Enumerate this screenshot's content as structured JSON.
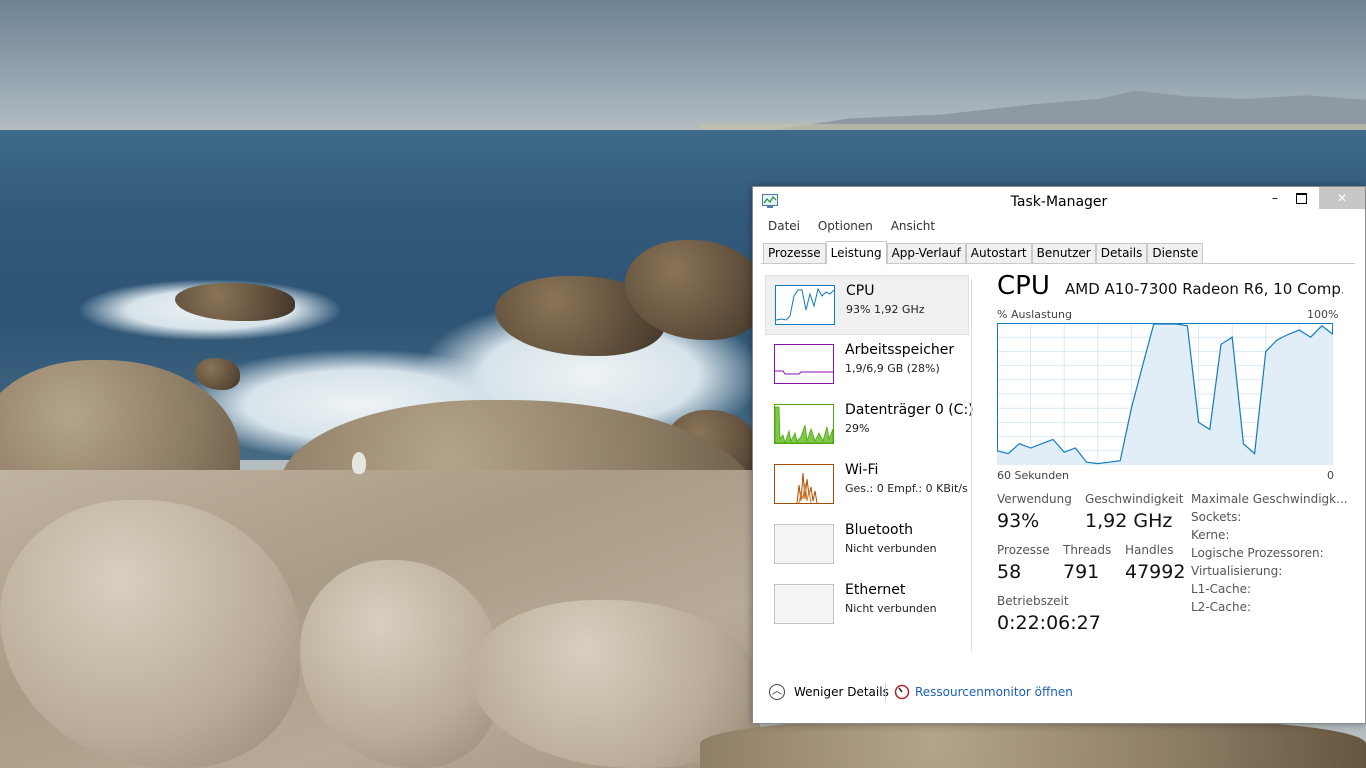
{
  "window": {
    "title": "Task-Manager",
    "controls": {
      "minimize": "–",
      "close": "✕"
    }
  },
  "menu": [
    "Datei",
    "Optionen",
    "Ansicht"
  ],
  "tabs": [
    {
      "label": "Prozesse",
      "active": false
    },
    {
      "label": "Leistung",
      "active": true
    },
    {
      "label": "App-Verlauf",
      "active": false
    },
    {
      "label": "Autostart",
      "active": false
    },
    {
      "label": "Benutzer",
      "active": false
    },
    {
      "label": "Details",
      "active": false
    },
    {
      "label": "Dienste",
      "active": false
    }
  ],
  "resources": [
    {
      "name": "CPU",
      "sub": "93% 1,92 GHz",
      "color": "#117dbb"
    },
    {
      "name": "Arbeitsspeicher",
      "sub": "1,9/6,9 GB (28%)",
      "color": "#8b12ae"
    },
    {
      "name": "Datenträger 0 (C:)",
      "sub": "29%",
      "color": "#4da60c"
    },
    {
      "name": "Wi-Fi",
      "sub": "Ges.: 0 Empf.: 0 KBit/s",
      "color": "#a74f01"
    },
    {
      "name": "Bluetooth",
      "sub": "Nicht verbunden",
      "color": "#a0a0a0"
    },
    {
      "name": "Ethernet",
      "sub": "Nicht verbunden",
      "color": "#a0a0a0"
    }
  ],
  "detail": {
    "title": "CPU",
    "cpu_name": "AMD A10-7300 Radeon R6, 10 Comp...",
    "graph_label": "% Auslastung",
    "graph_max": "100%",
    "time_label": "60 Sekunden",
    "time_min": "0",
    "stats": {
      "usage_label": "Verwendung",
      "usage": "93%",
      "speed_label": "Geschwindigkeit",
      "speed": "1,92 GHz",
      "processes_label": "Prozesse",
      "processes": "58",
      "threads_label": "Threads",
      "threads": "791",
      "handles_label": "Handles",
      "handles": "47992",
      "uptime_label": "Betriebszeit",
      "uptime": "0:22:06:27"
    },
    "specs": [
      "Maximale Geschwindigk...",
      "Sockets:",
      "Kerne:",
      "Logische Prozessoren:",
      "Virtualisierung:",
      "L1-Cache:",
      "L2-Cache:"
    ]
  },
  "footer": {
    "fewer_details": "Weniger Details",
    "resource_monitor": "Ressourcenmonitor öffnen"
  },
  "chart_data": {
    "type": "area",
    "ylim": [
      0,
      100
    ],
    "xlim": [
      60,
      0
    ],
    "x": [
      60,
      58,
      56,
      54,
      52,
      50,
      48,
      46,
      44,
      42,
      40,
      38,
      36,
      34,
      32,
      30,
      28,
      26,
      24,
      22,
      20,
      18,
      16,
      14,
      12,
      10,
      8,
      6,
      4,
      2,
      0
    ],
    "values": [
      10,
      8,
      15,
      12,
      15,
      18,
      9,
      12,
      2,
      1,
      2,
      3,
      40,
      70,
      100,
      100,
      100,
      98,
      30,
      25,
      85,
      90,
      15,
      8,
      80,
      88,
      92,
      95,
      90,
      98,
      92
    ],
    "grid": true
  }
}
